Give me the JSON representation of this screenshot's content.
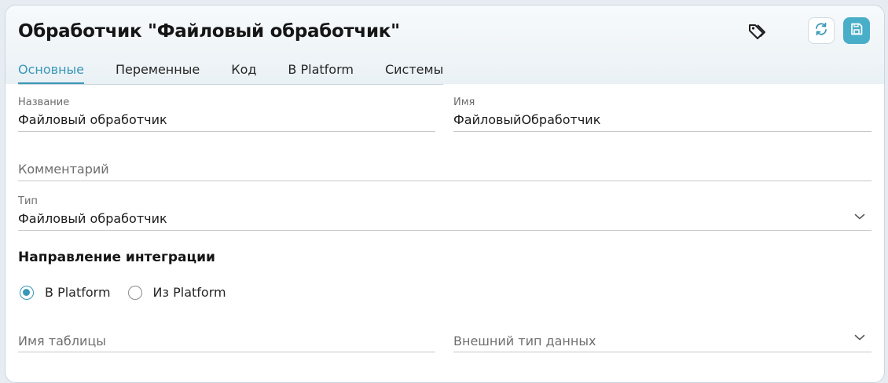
{
  "header": {
    "title": "Обработчик \"Файловый обработчик\""
  },
  "tabs": [
    {
      "label": "Основные"
    },
    {
      "label": "Переменные"
    },
    {
      "label": "Код"
    },
    {
      "label": "В Platform"
    },
    {
      "label": "Системы"
    }
  ],
  "fields": {
    "name": {
      "label": "Название",
      "value": "Файловый обработчик"
    },
    "identifier": {
      "label": "Имя",
      "value": "ФайловыйОбработчик"
    },
    "comment": {
      "placeholder": "Комментарий"
    },
    "type": {
      "label": "Тип",
      "value": "Файловый обработчик"
    },
    "table_name": {
      "placeholder": "Имя таблицы"
    },
    "external_type": {
      "placeholder": "Внешний тип данных"
    }
  },
  "direction": {
    "title": "Направление интеграции",
    "options": [
      {
        "label": "В Platform",
        "checked": true
      },
      {
        "label": "Из Platform",
        "checked": false
      }
    ]
  },
  "icons": {
    "tag": "tag-icon",
    "refresh": "refresh-icon",
    "save": "save-icon",
    "chevron": "chevron-down-icon"
  },
  "colors": {
    "accent": "#3a97b7",
    "save_button": "#49aec8"
  }
}
